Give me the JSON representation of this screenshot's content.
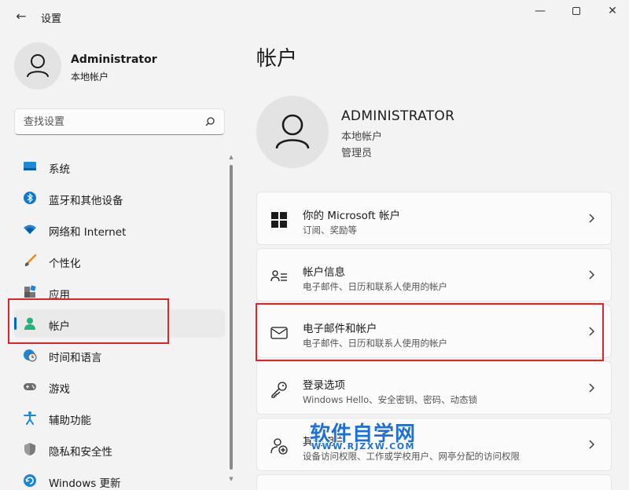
{
  "window": {
    "title": "设置",
    "back_glyph": "←",
    "minimize_glyph": "—",
    "close_glyph": "✕"
  },
  "sidebar": {
    "user_name": "Administrator",
    "user_type": "本地帐户",
    "search_placeholder": "查找设置",
    "items": [
      {
        "label": "系统",
        "icon": "monitor-icon",
        "active": false
      },
      {
        "label": "蓝牙和其他设备",
        "icon": "bluetooth-icon",
        "active": false
      },
      {
        "label": "网络和 Internet",
        "icon": "wifi-icon",
        "active": false
      },
      {
        "label": "个性化",
        "icon": "brush-icon",
        "active": false
      },
      {
        "label": "应用",
        "icon": "apps-icon",
        "active": false
      },
      {
        "label": "帐户",
        "icon": "person-icon",
        "active": true
      },
      {
        "label": "时间和语言",
        "icon": "globe-clock-icon",
        "active": false
      },
      {
        "label": "游戏",
        "icon": "gamepad-icon",
        "active": false
      },
      {
        "label": "辅助功能",
        "icon": "accessibility-icon",
        "active": false
      },
      {
        "label": "隐私和安全性",
        "icon": "shield-icon",
        "active": false
      },
      {
        "label": "Windows 更新",
        "icon": "update-icon",
        "active": false
      }
    ]
  },
  "main": {
    "page_title": "帐户",
    "account": {
      "name": "ADMINISTRATOR",
      "type": "本地帐户",
      "role": "管理员"
    },
    "cards": [
      {
        "title": "你的 Microsoft 帐户",
        "subtitle": "订阅、奖励等",
        "icon": "windows-logo-icon"
      },
      {
        "title": "帐户信息",
        "subtitle": "电子邮件、日历和联系人使用的帐户",
        "icon": "account-info-icon"
      },
      {
        "title": "电子邮件和帐户",
        "subtitle": "电子邮件、日历和联系人使用的帐户",
        "icon": "mail-icon"
      },
      {
        "title": "登录选项",
        "subtitle": "Windows Hello、安全密钥、密码、动态锁",
        "icon": "key-icon"
      },
      {
        "title": "其他用户",
        "subtitle": "设备访问权限、工作或学校用户、网亭分配的访问权限",
        "icon": "add-person-icon"
      }
    ]
  },
  "watermark": {
    "main": "软件自学网",
    "url": "WWW.RJZXW.COM"
  },
  "colors": {
    "accent": "#0067c0",
    "highlight_box": "#e0242b",
    "watermark": "#1e6fd8"
  }
}
